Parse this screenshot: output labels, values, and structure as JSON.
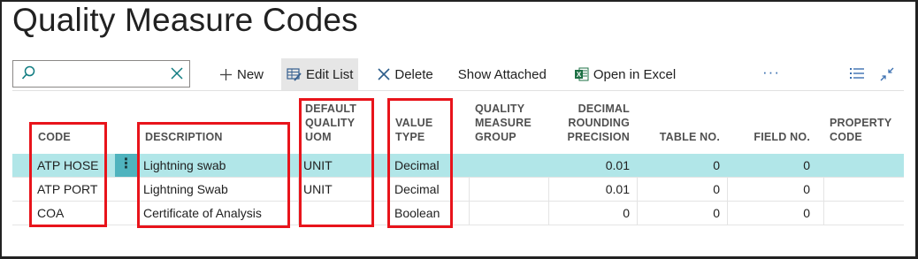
{
  "page": {
    "title": "Quality Measure Codes"
  },
  "search": {
    "placeholder": ""
  },
  "toolbar": {
    "new_label": "New",
    "edit_list_label": "Edit List",
    "delete_label": "Delete",
    "show_attached_label": "Show Attached",
    "open_excel_label": "Open in Excel",
    "more_label": "···"
  },
  "colors": {
    "accent": "#008489",
    "selected_row": "#b1e6e8",
    "highlight_box": "#e8141b",
    "excel_green": "#1e7145"
  },
  "columns": {
    "code": "CODE",
    "description": "DESCRIPTION",
    "default_uom": [
      "DEFAULT",
      "QUALITY",
      "UOM"
    ],
    "value_type": [
      "VALUE",
      "TYPE"
    ],
    "measure_group": [
      "QUALITY",
      "MEASURE",
      "GROUP"
    ],
    "rounding": [
      "DECIMAL",
      "ROUNDING",
      "PRECISION"
    ],
    "table_no": "TABLE NO.",
    "field_no": "FIELD NO.",
    "property_code": [
      "PROPERTY",
      "CODE"
    ]
  },
  "rows": [
    {
      "code": "ATP HOSE",
      "description": "Lightning swab",
      "uom": "UNIT",
      "value_type": "Decimal",
      "group": "",
      "rounding": "0.01",
      "table_no": "0",
      "field_no": "0",
      "property_code": ""
    },
    {
      "code": "ATP PORT",
      "description": "Lightning Swab",
      "uom": "UNIT",
      "value_type": "Decimal",
      "group": "",
      "rounding": "0.01",
      "table_no": "0",
      "field_no": "0",
      "property_code": ""
    },
    {
      "code": "COA",
      "description": "Certificate of Analysis",
      "uom": "",
      "value_type": "Boolean",
      "group": "",
      "rounding": "0",
      "table_no": "0",
      "field_no": "0",
      "property_code": ""
    }
  ]
}
